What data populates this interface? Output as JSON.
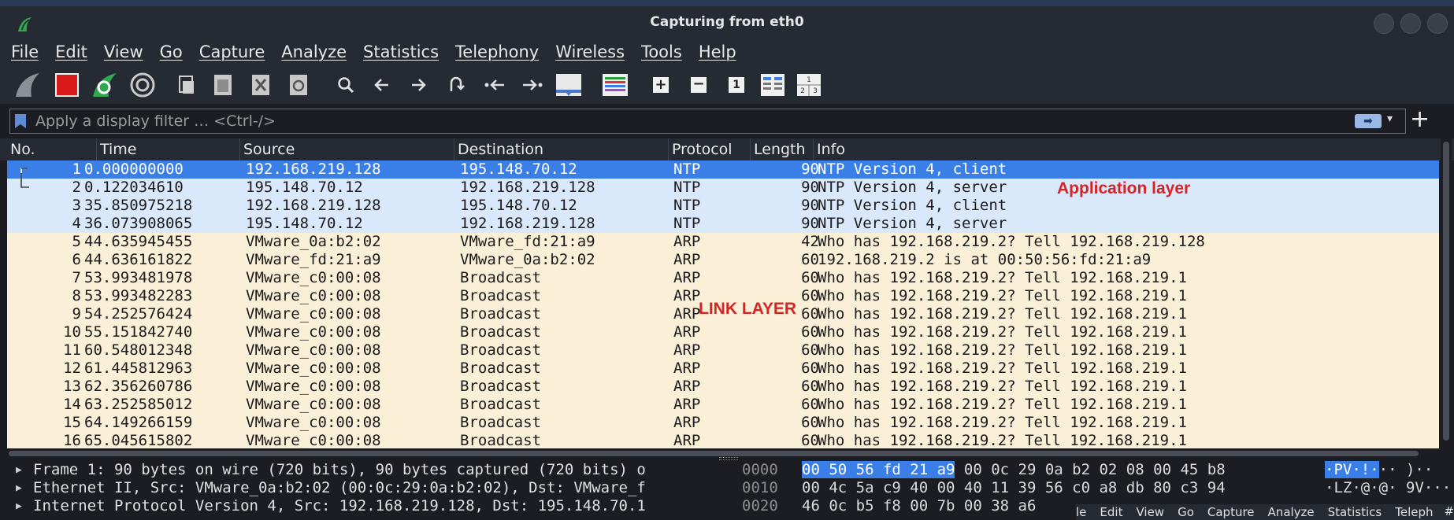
{
  "window": {
    "title": "Capturing from eth0"
  },
  "menu": [
    "File",
    "Edit",
    "View",
    "Go",
    "Capture",
    "Analyze",
    "Statistics",
    "Telephony",
    "Wireless",
    "Tools",
    "Help"
  ],
  "filter": {
    "placeholder": "Apply a display filter … <Ctrl-/>"
  },
  "columns": {
    "no": "No.",
    "time": "Time",
    "source": "Source",
    "destination": "Destination",
    "protocol": "Protocol",
    "length": "Length",
    "info": "Info"
  },
  "packets": [
    {
      "no": "1",
      "time": "0.000000000",
      "source": "192.168.219.128",
      "destination": "195.148.70.12",
      "protocol": "NTP",
      "length": "90",
      "info": "NTP Version 4, client"
    },
    {
      "no": "2",
      "time": "0.122034610",
      "source": "195.148.70.12",
      "destination": "192.168.219.128",
      "protocol": "NTP",
      "length": "90",
      "info": "NTP Version 4, server"
    },
    {
      "no": "3",
      "time": "35.850975218",
      "source": "192.168.219.128",
      "destination": "195.148.70.12",
      "protocol": "NTP",
      "length": "90",
      "info": "NTP Version 4, client"
    },
    {
      "no": "4",
      "time": "36.073908065",
      "source": "195.148.70.12",
      "destination": "192.168.219.128",
      "protocol": "NTP",
      "length": "90",
      "info": "NTP Version 4, server"
    },
    {
      "no": "5",
      "time": "44.635945455",
      "source": "VMware_0a:b2:02",
      "destination": "VMware_fd:21:a9",
      "protocol": "ARP",
      "length": "42",
      "info": "Who has 192.168.219.2? Tell 192.168.219.128"
    },
    {
      "no": "6",
      "time": "44.636161822",
      "source": "VMware_fd:21:a9",
      "destination": "VMware_0a:b2:02",
      "protocol": "ARP",
      "length": "60",
      "info": "192.168.219.2 is at 00:50:56:fd:21:a9"
    },
    {
      "no": "7",
      "time": "53.993481978",
      "source": "VMware_c0:00:08",
      "destination": "Broadcast",
      "protocol": "ARP",
      "length": "60",
      "info": "Who has 192.168.219.2? Tell 192.168.219.1"
    },
    {
      "no": "8",
      "time": "53.993482283",
      "source": "VMware_c0:00:08",
      "destination": "Broadcast",
      "protocol": "ARP",
      "length": "60",
      "info": "Who has 192.168.219.2? Tell 192.168.219.1"
    },
    {
      "no": "9",
      "time": "54.252576424",
      "source": "VMware_c0:00:08",
      "destination": "Broadcast",
      "protocol": "ARP",
      "length": "60",
      "info": "Who has 192.168.219.2? Tell 192.168.219.1"
    },
    {
      "no": "10",
      "time": "55.151842740",
      "source": "VMware_c0:00:08",
      "destination": "Broadcast",
      "protocol": "ARP",
      "length": "60",
      "info": "Who has 192.168.219.2? Tell 192.168.219.1"
    },
    {
      "no": "11",
      "time": "60.548012348",
      "source": "VMware_c0:00:08",
      "destination": "Broadcast",
      "protocol": "ARP",
      "length": "60",
      "info": "Who has 192.168.219.2? Tell 192.168.219.1"
    },
    {
      "no": "12",
      "time": "61.445812963",
      "source": "VMware_c0:00:08",
      "destination": "Broadcast",
      "protocol": "ARP",
      "length": "60",
      "info": "Who has 192.168.219.2? Tell 192.168.219.1"
    },
    {
      "no": "13",
      "time": "62.356260786",
      "source": "VMware_c0:00:08",
      "destination": "Broadcast",
      "protocol": "ARP",
      "length": "60",
      "info": "Who has 192.168.219.2? Tell 192.168.219.1"
    },
    {
      "no": "14",
      "time": "63.252585012",
      "source": "VMware_c0:00:08",
      "destination": "Broadcast",
      "protocol": "ARP",
      "length": "60",
      "info": "Who has 192.168.219.2? Tell 192.168.219.1"
    },
    {
      "no": "15",
      "time": "64.149266159",
      "source": "VMware_c0:00:08",
      "destination": "Broadcast",
      "protocol": "ARP",
      "length": "60",
      "info": "Who has 192.168.219.2? Tell 192.168.219.1"
    },
    {
      "no": "16",
      "time": "65.045615802",
      "source": "VMware_c0:00:08",
      "destination": "Broadcast",
      "protocol": "ARP",
      "length": "60",
      "info": "Who has 192.168.219.2? Tell 192.168.219.1"
    }
  ],
  "annotations": {
    "application": "Application layer",
    "link": "LINK LAYER"
  },
  "details": [
    "Frame 1: 90 bytes on wire (720 bits), 90 bytes captured (720 bits) o",
    "Ethernet II, Src: VMware_0a:b2:02 (00:0c:29:0a:b2:02), Dst: VMware_f",
    "Internet Protocol Version 4, Src: 192.168.219.128, Dst: 195.148.70.1"
  ],
  "bytes": [
    {
      "offset": "0000",
      "hex_sel": "00 50 56 fd 21 a9",
      "hex_rest": " 00 0c  29 0a b2 02 08 00 45 b8",
      "ascii_sel": "·PV·!·",
      "ascii_rest": "·· )··"
    },
    {
      "offset": "0010",
      "hex_sel": "",
      "hex_rest": "00 4c 5a c9 40 00 40 11  39 56 c0 a8 db 80 c3 94",
      "ascii_sel": "",
      "ascii_rest": "·LZ·@·@· 9V····"
    },
    {
      "offset": "0020",
      "hex_sel": "",
      "hex_rest": "46 0c b5 f8 00 7b 00 38  a6",
      "ascii_sel": "",
      "ascii_rest": ""
    }
  ],
  "overlay_menu": [
    "le",
    "Edit",
    "View",
    "Go",
    "Capture",
    "Analyze",
    "Statistics",
    "Teleph"
  ],
  "overlay_hash": "#",
  "colors": {
    "selected_row": "#3a7fe8",
    "udp_row": "#dae8fb",
    "arp_row": "#faefd7",
    "annotation": "#d62424"
  }
}
